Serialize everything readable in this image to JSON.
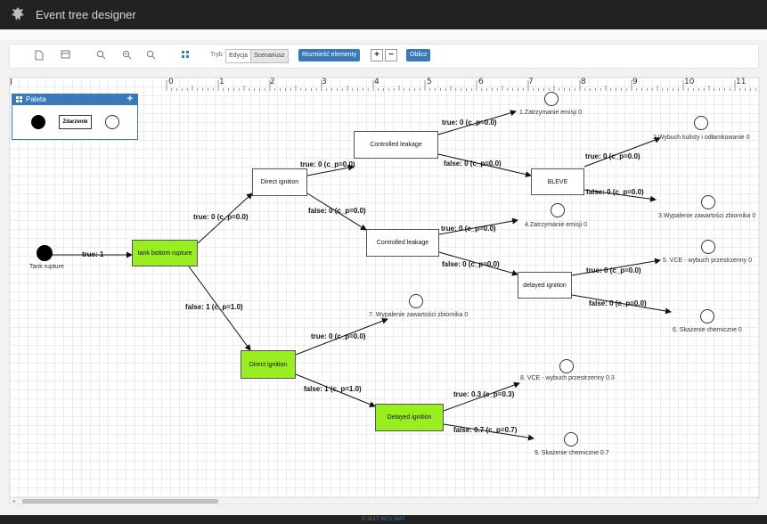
{
  "app": {
    "title": "Event tree designer"
  },
  "toolbar": {
    "icons": [
      "new-document-icon",
      "save-icon",
      "zoom-in-icon",
      "zoom-fit-icon",
      "zoom-out-icon",
      "grid-icon"
    ],
    "mode_label": "Tryb",
    "mode_options": [
      {
        "label": "Edycja",
        "active": false
      },
      {
        "label": "Scenariusz",
        "active": true
      }
    ],
    "arrange_label": "Rozmieść elementy",
    "plus": "+",
    "minus": "−",
    "compute_label": "Oblicz",
    "accent": "#3a79b8"
  },
  "ruler": {
    "corner": "I",
    "numbers": [
      "0",
      "1",
      "2",
      "3",
      "4",
      "5",
      "6",
      "7",
      "8",
      "9",
      "10",
      "11"
    ]
  },
  "palette": {
    "title": "Paleta",
    "event_label": "Zdarzenie",
    "add": "+"
  },
  "initiator": {
    "label": "Tank rupture",
    "edge": "true: 1"
  },
  "nodes": {
    "tank_bottom": "tank bottom rupture",
    "direct_ignition_top": "Direct ignition",
    "controlled_leakage_top": "Controlled leakage",
    "bleve": "BLEVE",
    "controlled_leakage_mid": "Controlled leakage",
    "delayed_ignition_top": "delayed ignition",
    "direct_ignition_bottom": "Direct ignition",
    "delayed_ignition_bottom": "Delayed ignition"
  },
  "edges": {
    "tb_to_di_top": "true: 0 (c_p=0.0)",
    "tb_to_di_bottom": "false: 1 (c_p=1.0)",
    "di_top_true": "true: 0 (c_p=0.0)",
    "di_top_false": "false: 0 (c_p=0.0)",
    "cl_top_true": "true: 0 (c_p=0.0)",
    "cl_top_false": "false: 0 (c_p=0.0)",
    "bleve_true": "true: 0 (c_p=0.0)",
    "bleve_false": "false: 0 (c_p=0.0)",
    "cl_mid_true": "true: 0 (c_p=0.0)",
    "cl_mid_false": "false: 0 (c_p=0.0)",
    "dl_top_true": "true: 0 (c_p=0.0)",
    "dl_top_false": "false: 0 (c_p=0.0)",
    "di_bottom_true": "true: 0 (c_p=0.0)",
    "di_bottom_false": "false: 1 (c_p=1.0)",
    "dl_bottom_true": "true: 0.3 (c_p=0.3)",
    "dl_bottom_false": "false: 0.7 (c_p=0.7)"
  },
  "outcomes": {
    "o1": "1.Zatrzymanie emisji 0",
    "o2": "2.Wybuch kulisty i odłamkowanie 0",
    "o3": "3.Wypalenie zawartości zbiornika 0",
    "o4": "4.Zatrzymanie emisji 0",
    "o5": "5. VCE - wybuch przestrzenny 0",
    "o6": "6. Skażenie chemiczne 0",
    "o7": "7. Wypalenie zawartości zbiornika 0",
    "o8": "8. VCE - wybuch przestrzenny 0.3",
    "o9": "9. Skażenie chemiczne 0.7"
  },
  "footer": {
    "copyright": "© 2017",
    "org": "WCY WAT"
  },
  "colors": {
    "node_highlight": "#99ee22",
    "topbar": "#222222",
    "accent": "#3a79b8"
  }
}
